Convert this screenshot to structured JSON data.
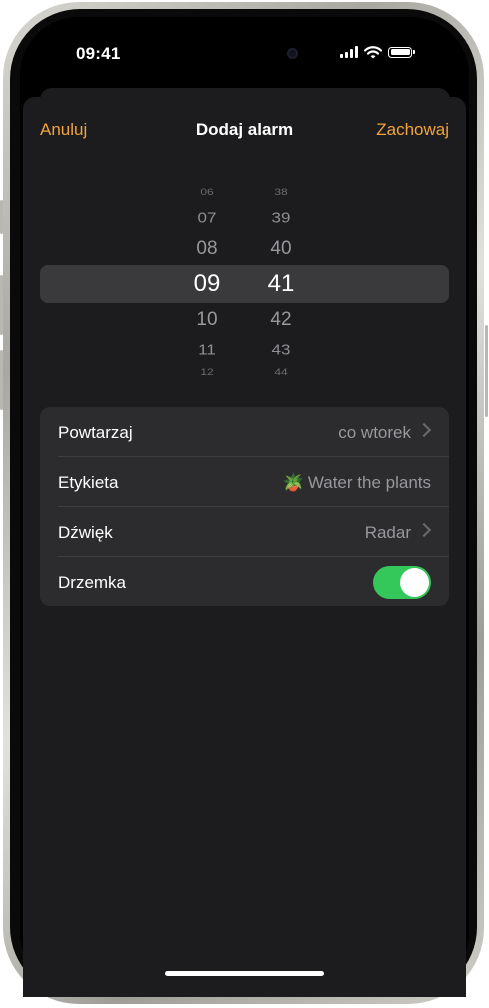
{
  "status_bar": {
    "time": "09:41"
  },
  "nav": {
    "cancel": "Anuluj",
    "title": "Dodaj alarm",
    "save": "Zachowaj"
  },
  "picker": {
    "hours": {
      "above": [
        "06",
        "07",
        "08"
      ],
      "selected": "09",
      "below": [
        "10",
        "11",
        "12"
      ]
    },
    "minutes": {
      "above": [
        "38",
        "39",
        "40"
      ],
      "selected": "41",
      "below": [
        "42",
        "43",
        "44"
      ]
    }
  },
  "settings": {
    "repeat": {
      "label": "Powtarzaj",
      "value": "co wtorek"
    },
    "label": {
      "label": "Etykieta",
      "emoji": "🪴",
      "value": "Water the plants"
    },
    "sound": {
      "label": "Dźwięk",
      "value": "Radar"
    },
    "snooze": {
      "label": "Drzemka",
      "on": true
    }
  },
  "colors": {
    "accent": "#f1a33c",
    "toggle_on": "#34c759",
    "sheet": "#1c1c1e",
    "list": "#2c2c2e"
  }
}
